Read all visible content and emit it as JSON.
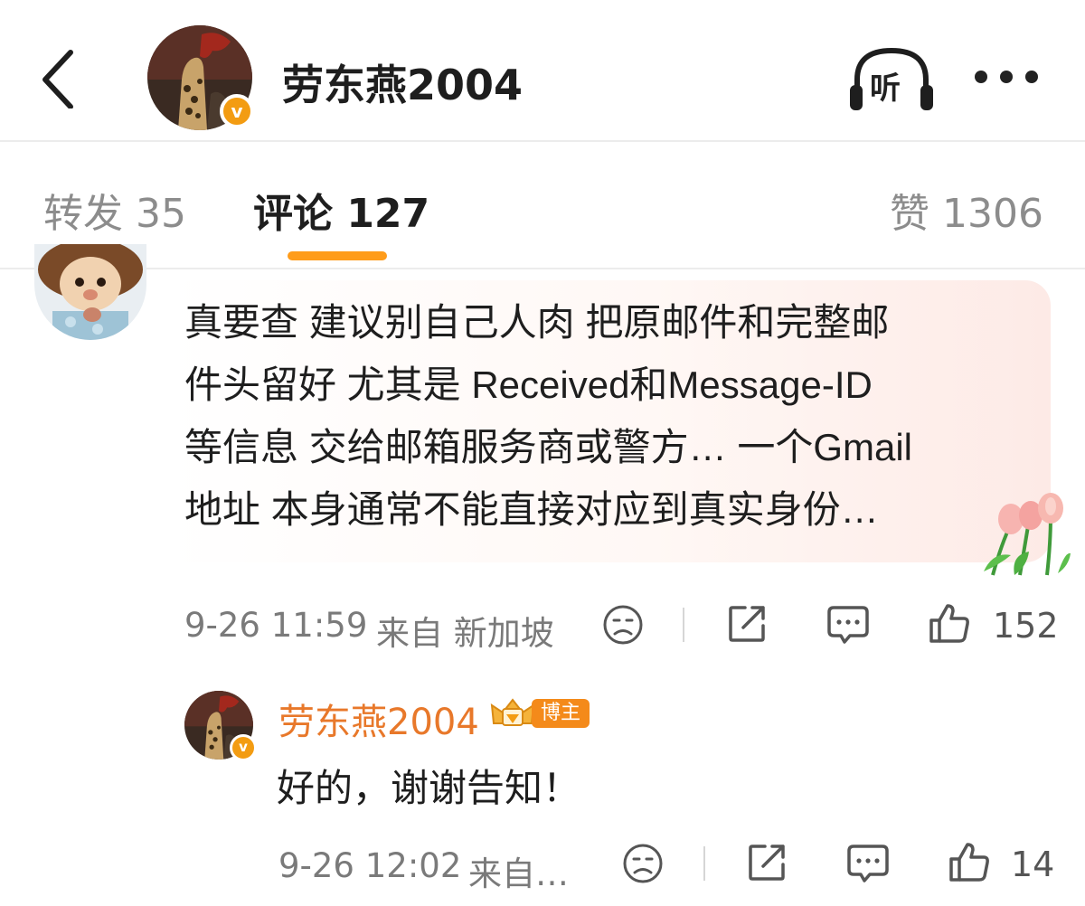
{
  "header": {
    "title": "劳东燕2004",
    "listen_label": "听",
    "verified_mark": "v"
  },
  "tabs": {
    "repost": "转发 35",
    "comment": "评论 127",
    "like": "赞 1306"
  },
  "comments": [
    {
      "text_lines": [
        "真要查 建议别自己人肉 把原邮件和完整邮",
        "件头留好 尤其是 Received和Message-ID",
        "等信息 交给邮箱服务商或警方… 一个Gmail",
        "地址 本身通常不能直接对应到真实身份…"
      ],
      "time": "9-26 11:59",
      "location": "来自 新加坡",
      "like_count": "152"
    }
  ],
  "reply": {
    "author": "劳东燕2004",
    "badge": "博主",
    "text": "好的，谢谢告知！",
    "time": "9-26 12:02",
    "location": "来自…",
    "like_count": "14"
  },
  "colors": {
    "accent": "#ff9c1a",
    "author_name": "#e8782a",
    "muted_text": "#8c8c8c"
  },
  "icons": [
    "back-arrow-icon",
    "headphones-icon",
    "more-dots-icon",
    "sad-face-icon",
    "share-icon",
    "comment-icon",
    "thumbs-up-icon",
    "tulip-sticker",
    "crown-badge-icon"
  ]
}
